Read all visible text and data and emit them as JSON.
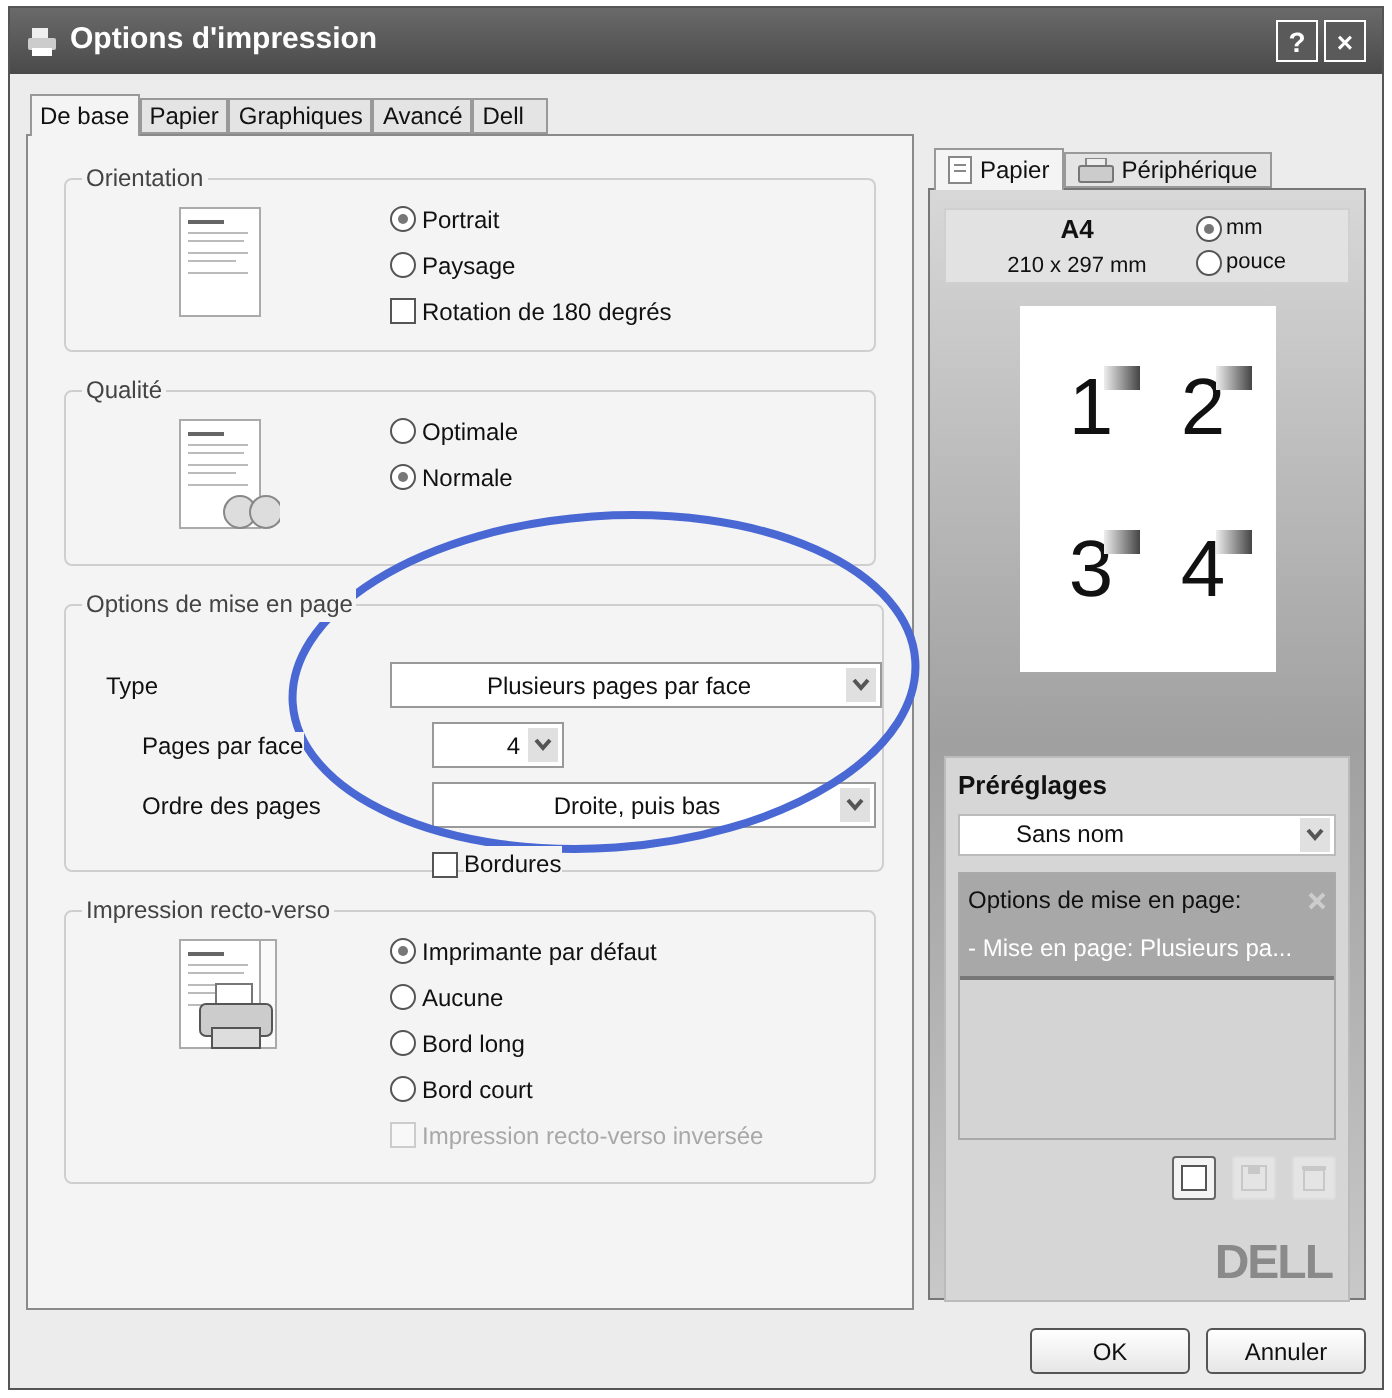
{
  "window": {
    "title": "Options d'impression",
    "controls": [
      "?",
      "×"
    ]
  },
  "tabs": [
    {
      "label": "De base",
      "selected": true
    },
    {
      "label": "Papier",
      "selected": false
    },
    {
      "label": "Graphiques",
      "selected": false
    },
    {
      "label": "Avancé",
      "selected": false
    },
    {
      "label": "Dell",
      "selected": false
    }
  ],
  "groups": [
    {
      "kind": "orientation",
      "title": "Orientation",
      "options": [
        {
          "kind": "radio",
          "label": "Portrait",
          "selected": true,
          "disabled": false
        },
        {
          "kind": "radio",
          "label": "Paysage",
          "selected": false,
          "disabled": false
        },
        {
          "kind": "checkbox",
          "label": "Rotation de 180 degrés",
          "checked": false,
          "disabled": false
        }
      ]
    },
    {
      "kind": "quality",
      "title": "Qualité",
      "options": [
        {
          "kind": "radio",
          "label": "Optimale",
          "selected": false,
          "disabled": false
        },
        {
          "kind": "radio",
          "label": "Normale",
          "selected": true,
          "disabled": false
        }
      ]
    },
    {
      "kind": "layout",
      "title": "Options de mise en page",
      "type": {
        "label": "Type",
        "value": "Plusieurs pages par face"
      },
      "pages_per_side": {
        "label": "Pages par face",
        "value": "4"
      },
      "page_order": {
        "label": "Ordre des pages",
        "value": "Droite, puis bas"
      },
      "borders": {
        "label": "Bordures",
        "checked": false
      }
    },
    {
      "kind": "duplex",
      "title": "Impression recto-verso",
      "options": [
        {
          "kind": "radio",
          "label": "Imprimante par défaut",
          "selected": true,
          "disabled": false
        },
        {
          "kind": "radio",
          "label": "Aucune",
          "selected": false,
          "disabled": false
        },
        {
          "kind": "radio",
          "label": "Bord long",
          "selected": false,
          "disabled": false
        },
        {
          "kind": "radio",
          "label": "Bord court",
          "selected": false,
          "disabled": false
        },
        {
          "kind": "checkbox",
          "label": "Impression recto-verso inversée",
          "checked": false,
          "disabled": true
        }
      ]
    }
  ],
  "side_tabs": [
    {
      "kind": "paper",
      "label": "Papier",
      "selected": true
    },
    {
      "kind": "device",
      "label": "Périphérique",
      "selected": false
    }
  ],
  "paper": {
    "size": "A4",
    "dimensions": "210 x 297 mm",
    "units": [
      {
        "label": "mm",
        "selected": true
      },
      {
        "label": "pouce",
        "selected": false
      }
    ]
  },
  "preview": {
    "pages": [
      "1",
      "2",
      "3",
      "4"
    ]
  },
  "presets": {
    "title": "Préréglages",
    "value": "Sans nom",
    "summary": {
      "heading": "Options de mise en page:",
      "line": "- Mise en page: Plusieurs pa...",
      "selected": true
    },
    "actions": [
      {
        "kind": "new",
        "disabled": false
      },
      {
        "kind": "save",
        "disabled": true
      },
      {
        "kind": "delete",
        "disabled": true
      }
    ]
  },
  "logo": "DELL",
  "buttons": [
    "OK",
    "Annuler"
  ]
}
